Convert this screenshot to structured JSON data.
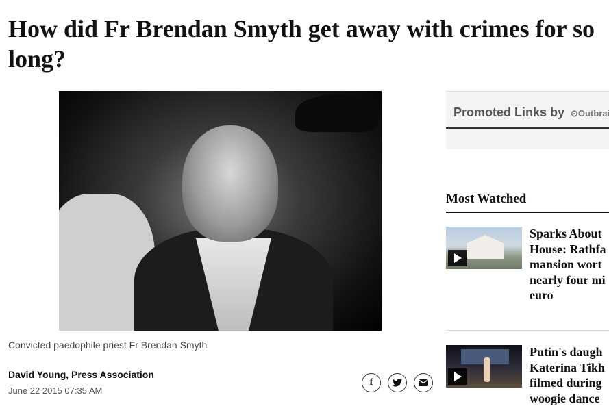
{
  "article": {
    "headline_line1": "How did Fr Brendan Smyth get away with crimes for so",
    "headline_line2": "long?",
    "caption": "Convicted paedophile priest Fr Brendan Smyth",
    "author": "David Young, Press Association",
    "date": "June 22 2015 07:35 AM"
  },
  "share": {
    "facebook_glyph": "f",
    "twitter_glyph": "🐦",
    "email_glyph": "✉"
  },
  "promoted": {
    "title": "Promoted Links by",
    "provider": "Outbrain"
  },
  "most_watched": {
    "title": "Most Watched",
    "items": [
      {
        "line1": "Sparks About",
        "line2": "House: Rathfa",
        "line3": "mansion wort",
        "line4": "nearly four mi",
        "line5": "euro",
        "icon": "house-thumbnail"
      },
      {
        "line1": "Putin's daugh",
        "line2": "Katerina Tikh",
        "line3": "filmed during",
        "line4": "woogie dance",
        "icon": "stage-thumbnail"
      }
    ]
  }
}
